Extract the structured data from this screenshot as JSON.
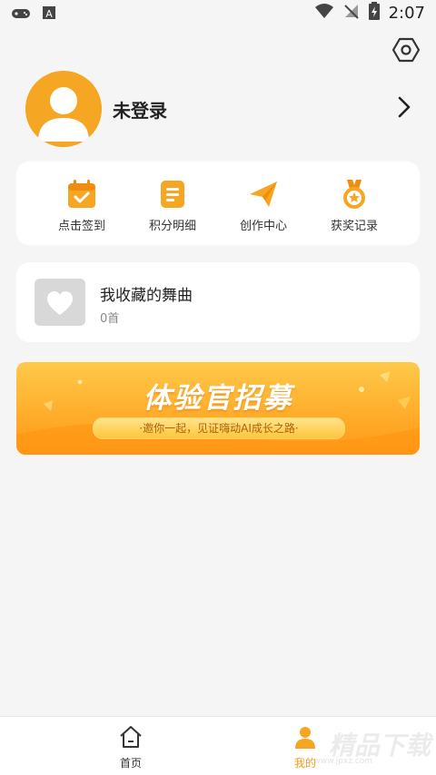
{
  "status_bar": {
    "time": "2:07"
  },
  "profile": {
    "nickname": "未登录"
  },
  "quick_actions": [
    {
      "label": "点击签到",
      "icon": "calendar-check-icon"
    },
    {
      "label": "积分明细",
      "icon": "document-list-icon"
    },
    {
      "label": "创作中心",
      "icon": "paper-plane-icon"
    },
    {
      "label": "获奖记录",
      "icon": "medal-icon"
    }
  ],
  "favorites": {
    "title": "我收藏的舞曲",
    "count": "0首"
  },
  "banner": {
    "title": "体验官招募",
    "subtitle": "·邀你一起，见证嗨动AI成长之路·"
  },
  "tabs": [
    {
      "label": "首页",
      "icon": "home-icon"
    },
    {
      "label": "我的",
      "icon": "profile-icon"
    }
  ],
  "watermark": {
    "text": "精品下载",
    "url": "www.jpxz.com"
  },
  "colors": {
    "accent": "#f5a623",
    "background": "#f5f5f5",
    "card": "#ffffff"
  }
}
